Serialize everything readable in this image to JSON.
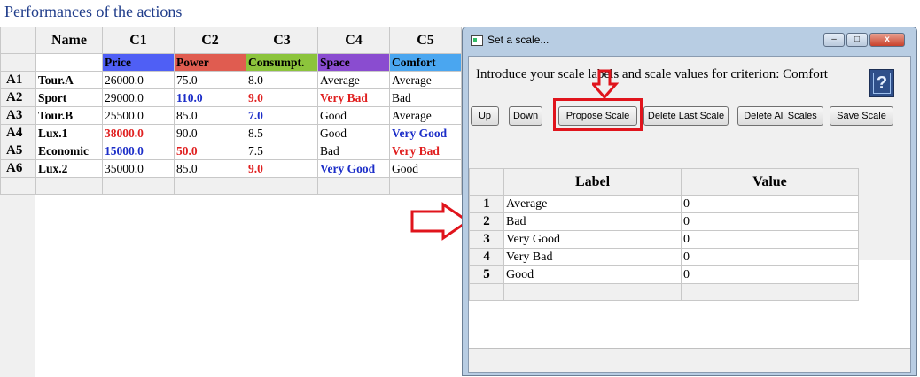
{
  "page": {
    "title": "Performances of the actions"
  },
  "perf_table": {
    "col_ids": [
      "Name",
      "C1",
      "C2",
      "C3",
      "C4",
      "C5"
    ],
    "criteria": [
      {
        "label": "Price",
        "color": "#4f5ff5"
      },
      {
        "label": "Power",
        "color": "#e05c50"
      },
      {
        "label": "Consumpt.",
        "color": "#8cc43c"
      },
      {
        "label": "Space",
        "color": "#8a4cd0"
      },
      {
        "label": "Comfort",
        "color": "#4aa6f0"
      }
    ],
    "rows": [
      {
        "id": "A1",
        "name": "Tour.A",
        "cells": [
          {
            "v": "26000.0",
            "s": ""
          },
          {
            "v": "75.0",
            "s": ""
          },
          {
            "v": "8.0",
            "s": ""
          },
          {
            "v": "Average",
            "s": ""
          },
          {
            "v": "Average",
            "s": ""
          }
        ]
      },
      {
        "id": "A2",
        "name": "Sport",
        "cells": [
          {
            "v": "29000.0",
            "s": ""
          },
          {
            "v": "110.0",
            "s": "blue"
          },
          {
            "v": "9.0",
            "s": "red"
          },
          {
            "v": "Very Bad",
            "s": "red"
          },
          {
            "v": "Bad",
            "s": ""
          }
        ]
      },
      {
        "id": "A3",
        "name": "Tour.B",
        "cells": [
          {
            "v": "25500.0",
            "s": ""
          },
          {
            "v": "85.0",
            "s": ""
          },
          {
            "v": "7.0",
            "s": "blue"
          },
          {
            "v": "Good",
            "s": ""
          },
          {
            "v": "Average",
            "s": ""
          }
        ]
      },
      {
        "id": "A4",
        "name": "Lux.1",
        "cells": [
          {
            "v": "38000.0",
            "s": "red"
          },
          {
            "v": "90.0",
            "s": ""
          },
          {
            "v": "8.5",
            "s": ""
          },
          {
            "v": "Good",
            "s": ""
          },
          {
            "v": "Very Good",
            "s": "blue"
          }
        ]
      },
      {
        "id": "A5",
        "name": "Economic",
        "cells": [
          {
            "v": "15000.0",
            "s": "blue"
          },
          {
            "v": "50.0",
            "s": "red"
          },
          {
            "v": "7.5",
            "s": ""
          },
          {
            "v": "Bad",
            "s": ""
          },
          {
            "v": "Very Bad",
            "s": "red"
          }
        ]
      },
      {
        "id": "A6",
        "name": "Lux.2",
        "cells": [
          {
            "v": "35000.0",
            "s": ""
          },
          {
            "v": "85.0",
            "s": ""
          },
          {
            "v": "9.0",
            "s": "red"
          },
          {
            "v": "Very Good",
            "s": "blue"
          },
          {
            "v": "Good",
            "s": ""
          }
        ]
      }
    ]
  },
  "dialog": {
    "title": "Set a scale...",
    "window_controls": [
      "–",
      "□",
      "x"
    ],
    "intro": "Introduce your scale labels and scale values for criterion:  Comfort",
    "help_icon": "help-book-icon",
    "help_glyph": "?",
    "buttons": [
      "Up",
      "Down",
      "Propose Scale",
      "Delete Last Scale",
      "Delete All Scales",
      "Save Scale"
    ],
    "highlighted_button": "Propose Scale",
    "highlight_color": "#e0141c",
    "scale_table": {
      "headers": [
        "Label",
        "Value"
      ],
      "rows": [
        {
          "n": "1",
          "label": "Average",
          "value": "0"
        },
        {
          "n": "2",
          "label": "Bad",
          "value": "0"
        },
        {
          "n": "3",
          "label": "Very Good",
          "value": "0"
        },
        {
          "n": "4",
          "label": "Very Bad",
          "value": "0"
        },
        {
          "n": "5",
          "label": "Good",
          "value": "0"
        }
      ]
    }
  }
}
